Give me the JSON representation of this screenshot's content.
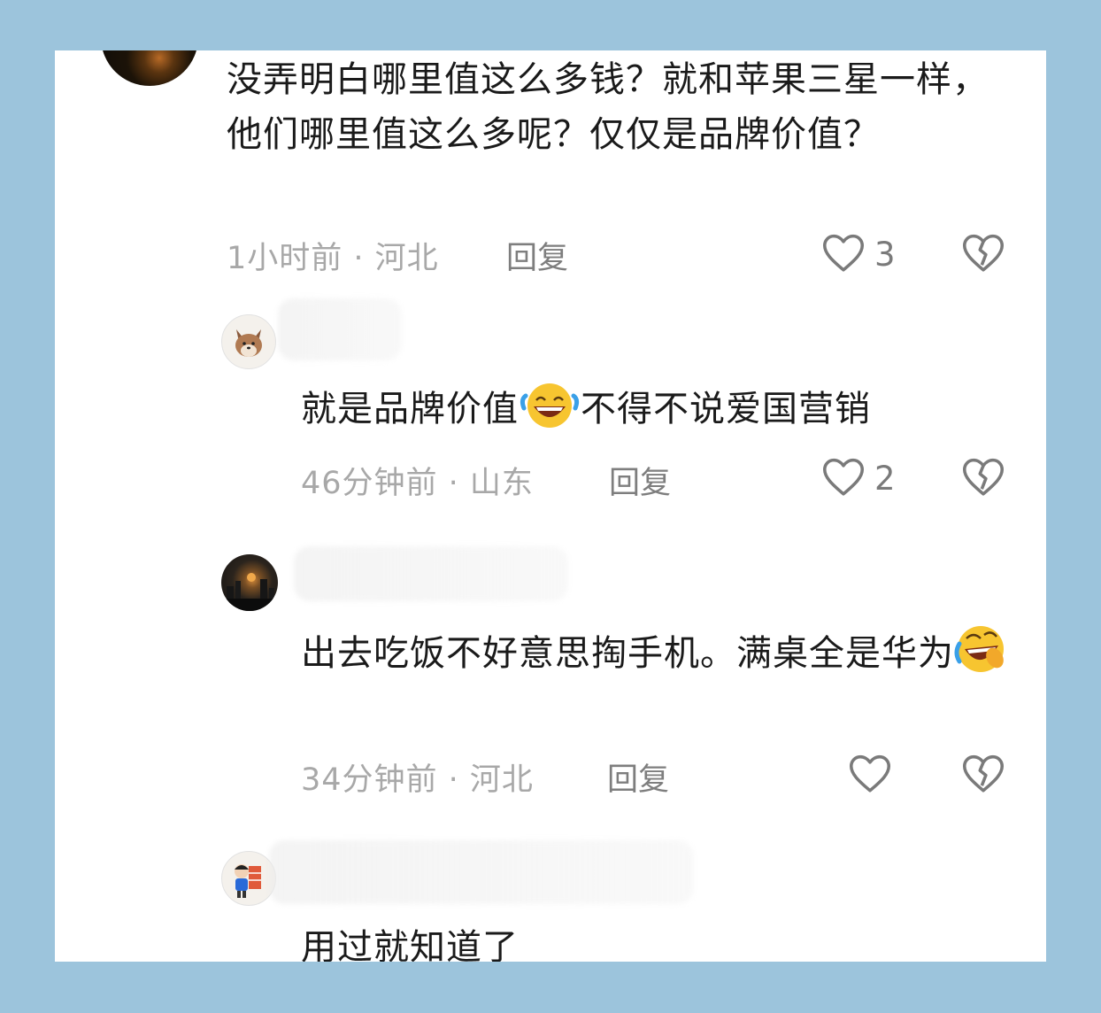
{
  "comments": [
    {
      "text": "没弄明白哪里值这么多钱？就和苹果三星一样，他们哪里值这么多呢？仅仅是品牌价值？",
      "meta": "1小时前 · 河北",
      "reply_label": "回复",
      "likes": "3"
    },
    {
      "text_before": "就是品牌价值",
      "emoji": "laughing-crying",
      "text_after": "不得不说爱国营销",
      "meta": "46分钟前 · 山东",
      "reply_label": "回复",
      "likes": "2"
    },
    {
      "text": "出去吃饭不好意思掏手机。满桌全是华为",
      "emoji": "rolling-laughing",
      "meta": "34分钟前 · 河北",
      "reply_label": "回复",
      "likes": ""
    },
    {
      "text": "用过就知道了"
    }
  ],
  "colors": {
    "frame": "#9cc4dc",
    "card": "#ffffff",
    "text": "#1a1a1a",
    "meta": "#a8a8a8",
    "icon": "#7a7a7a"
  }
}
